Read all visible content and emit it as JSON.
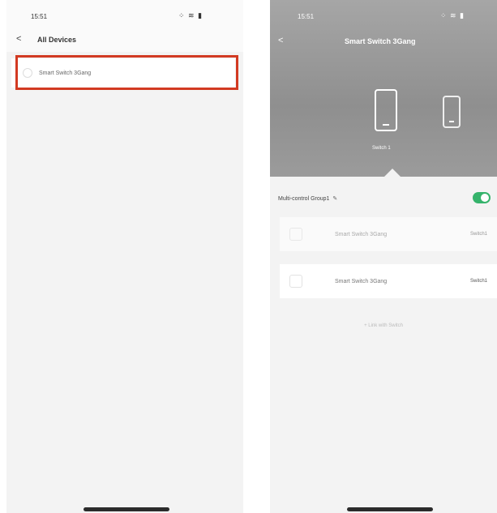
{
  "left_screen": {
    "status": {
      "time": "15:51",
      "icons": "⁘ ≋ ▮"
    },
    "back_label": "<",
    "title": "All Devices",
    "devices": [
      {
        "label": "Smart Switch 3Gang"
      }
    ]
  },
  "right_screen": {
    "status": {
      "time": "15:51",
      "icons": "⁘ ≋ ▮"
    },
    "back_label": "<",
    "title": "Smart Switch 3Gang",
    "selected_switch_label": "Switch 1",
    "group": {
      "name": "Multi-control Group1",
      "edit_icon": "✎",
      "toggle_on": true
    },
    "linked_devices": [
      {
        "name": "Smart Switch 3Gang",
        "channel": "Switch1"
      },
      {
        "name": "Smart Switch 3Gang",
        "channel": "Switch1"
      }
    ],
    "add_link_label": "+  Link with Switch"
  },
  "colors": {
    "highlight": "#d23a22",
    "toggle_on": "#35b36b",
    "hero_bg": "#9c9c9c"
  }
}
